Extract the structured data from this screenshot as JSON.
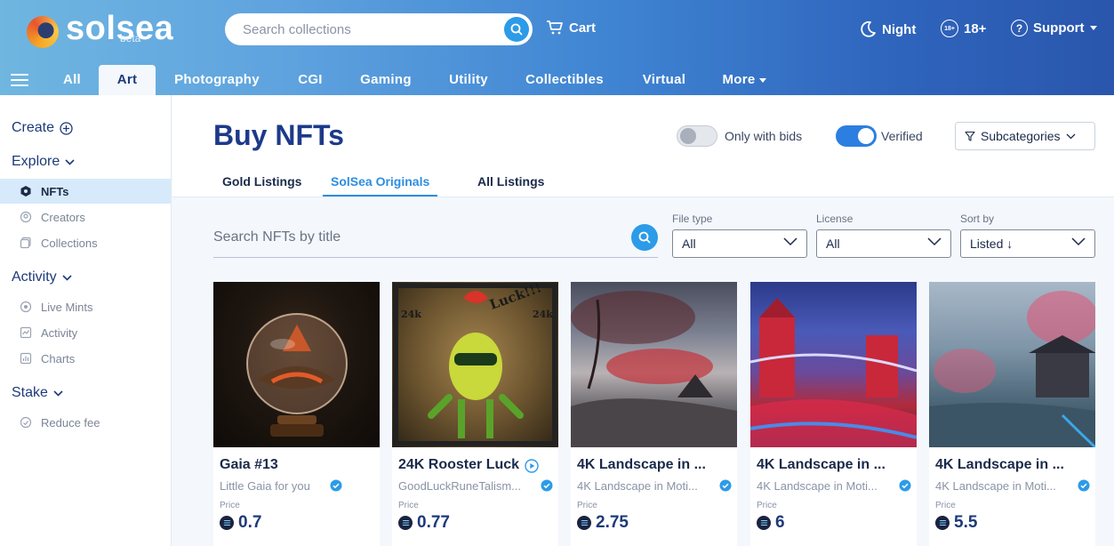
{
  "brand": {
    "name": "solsea",
    "badge": "beta"
  },
  "header": {
    "search_placeholder": "Search collections",
    "cart_label": "Cart",
    "night_label": "Night",
    "age_label": "18+",
    "age_icon_text": "18+",
    "support_label": "Support"
  },
  "categories": [
    "All",
    "Art",
    "Photography",
    "CGI",
    "Gaming",
    "Utility",
    "Collectibles",
    "Virtual",
    "More"
  ],
  "active_category": "Art",
  "sidebar": {
    "create": "Create",
    "explore": "Explore",
    "explore_items": [
      "NFTs",
      "Creators",
      "Collections"
    ],
    "activity": "Activity",
    "activity_items": [
      "Live Mints",
      "Activity",
      "Charts"
    ],
    "stake": "Stake",
    "stake_items": [
      "Reduce fee"
    ]
  },
  "main": {
    "title": "Buy NFTs",
    "only_bids_label": "Only with bids",
    "only_bids_on": false,
    "verified_label": "Verified",
    "verified_on": true,
    "subcategories_label": "Subcategories",
    "tabs": [
      "Gold Listings",
      "SolSea Originals",
      "All Listings"
    ],
    "active_tab": "SolSea Originals",
    "nft_search_placeholder": "Search NFTs by title",
    "filters": [
      {
        "label": "File type",
        "value": "All"
      },
      {
        "label": "License",
        "value": "All"
      },
      {
        "label": "Sort by",
        "value": "Listed ↓"
      }
    ]
  },
  "cards": [
    {
      "name": "Gaia #13",
      "collection": "Little Gaia for you",
      "price_label": "Price",
      "price": "0.7"
    },
    {
      "name": "24K Rooster Luck",
      "collection": "GoodLuckRuneTalism...",
      "price_label": "Price",
      "price": "0.77"
    },
    {
      "name": "4K Landscape in ...",
      "collection": "4K Landscape in Moti...",
      "price_label": "Price",
      "price": "2.75"
    },
    {
      "name": "4K Landscape in ...",
      "collection": "4K Landscape in Moti...",
      "price_label": "Price",
      "price": "6"
    },
    {
      "name": "4K Landscape in ...",
      "collection": "4K Landscape in Moti...",
      "price_label": "Price",
      "price": "5.5"
    }
  ],
  "colors": {
    "accent": "#2c8ee0",
    "title": "#1d3a8a",
    "sidebar_active": "#d6eafb"
  }
}
